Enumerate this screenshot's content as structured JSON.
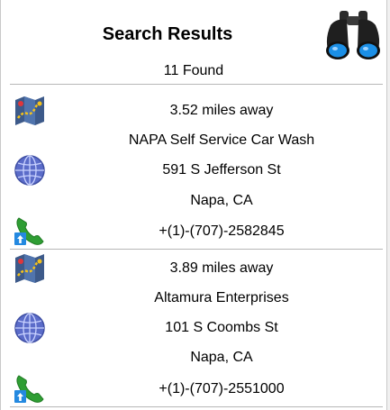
{
  "header": {
    "title": "Search Results",
    "count_text": "11 Found"
  },
  "icons": {
    "binoculars": "binoculars-icon",
    "map": "map-icon",
    "globe": "globe-icon",
    "phone": "phone-icon"
  },
  "colors": {
    "divider": "#b7b7b7",
    "globe": "#5b6cc9",
    "phone": "#2f9e34",
    "lens": "#1b8fe6"
  },
  "results": [
    {
      "distance": "3.52 miles away",
      "name": "NAPA Self Service Car Wash",
      "street": "591 S Jefferson St",
      "city": "Napa, CA",
      "phone": "+(1)-(707)-2582845"
    },
    {
      "distance": "3.89 miles away",
      "name": "Altamura Enterprises",
      "street": "101 S Coombs St",
      "city": "Napa, CA",
      "phone": "+(1)-(707)-2551000"
    }
  ]
}
